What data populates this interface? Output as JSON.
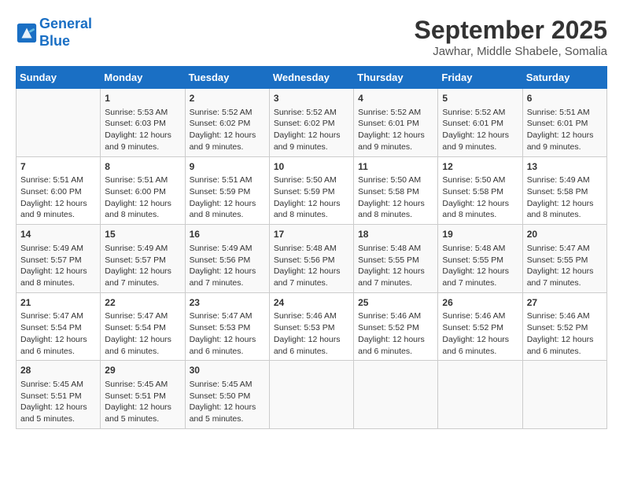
{
  "header": {
    "logo_line1": "General",
    "logo_line2": "Blue",
    "title": "September 2025",
    "subtitle": "Jawhar, Middle Shabele, Somalia"
  },
  "days_of_week": [
    "Sunday",
    "Monday",
    "Tuesday",
    "Wednesday",
    "Thursday",
    "Friday",
    "Saturday"
  ],
  "weeks": [
    [
      {
        "day": "",
        "content": ""
      },
      {
        "day": "1",
        "content": "Sunrise: 5:53 AM\nSunset: 6:03 PM\nDaylight: 12 hours\nand 9 minutes."
      },
      {
        "day": "2",
        "content": "Sunrise: 5:52 AM\nSunset: 6:02 PM\nDaylight: 12 hours\nand 9 minutes."
      },
      {
        "day": "3",
        "content": "Sunrise: 5:52 AM\nSunset: 6:02 PM\nDaylight: 12 hours\nand 9 minutes."
      },
      {
        "day": "4",
        "content": "Sunrise: 5:52 AM\nSunset: 6:01 PM\nDaylight: 12 hours\nand 9 minutes."
      },
      {
        "day": "5",
        "content": "Sunrise: 5:52 AM\nSunset: 6:01 PM\nDaylight: 12 hours\nand 9 minutes."
      },
      {
        "day": "6",
        "content": "Sunrise: 5:51 AM\nSunset: 6:01 PM\nDaylight: 12 hours\nand 9 minutes."
      }
    ],
    [
      {
        "day": "7",
        "content": "Sunrise: 5:51 AM\nSunset: 6:00 PM\nDaylight: 12 hours\nand 9 minutes."
      },
      {
        "day": "8",
        "content": "Sunrise: 5:51 AM\nSunset: 6:00 PM\nDaylight: 12 hours\nand 8 minutes."
      },
      {
        "day": "9",
        "content": "Sunrise: 5:51 AM\nSunset: 5:59 PM\nDaylight: 12 hours\nand 8 minutes."
      },
      {
        "day": "10",
        "content": "Sunrise: 5:50 AM\nSunset: 5:59 PM\nDaylight: 12 hours\nand 8 minutes."
      },
      {
        "day": "11",
        "content": "Sunrise: 5:50 AM\nSunset: 5:58 PM\nDaylight: 12 hours\nand 8 minutes."
      },
      {
        "day": "12",
        "content": "Sunrise: 5:50 AM\nSunset: 5:58 PM\nDaylight: 12 hours\nand 8 minutes."
      },
      {
        "day": "13",
        "content": "Sunrise: 5:49 AM\nSunset: 5:58 PM\nDaylight: 12 hours\nand 8 minutes."
      }
    ],
    [
      {
        "day": "14",
        "content": "Sunrise: 5:49 AM\nSunset: 5:57 PM\nDaylight: 12 hours\nand 8 minutes."
      },
      {
        "day": "15",
        "content": "Sunrise: 5:49 AM\nSunset: 5:57 PM\nDaylight: 12 hours\nand 7 minutes."
      },
      {
        "day": "16",
        "content": "Sunrise: 5:49 AM\nSunset: 5:56 PM\nDaylight: 12 hours\nand 7 minutes."
      },
      {
        "day": "17",
        "content": "Sunrise: 5:48 AM\nSunset: 5:56 PM\nDaylight: 12 hours\nand 7 minutes."
      },
      {
        "day": "18",
        "content": "Sunrise: 5:48 AM\nSunset: 5:55 PM\nDaylight: 12 hours\nand 7 minutes."
      },
      {
        "day": "19",
        "content": "Sunrise: 5:48 AM\nSunset: 5:55 PM\nDaylight: 12 hours\nand 7 minutes."
      },
      {
        "day": "20",
        "content": "Sunrise: 5:47 AM\nSunset: 5:55 PM\nDaylight: 12 hours\nand 7 minutes."
      }
    ],
    [
      {
        "day": "21",
        "content": "Sunrise: 5:47 AM\nSunset: 5:54 PM\nDaylight: 12 hours\nand 6 minutes."
      },
      {
        "day": "22",
        "content": "Sunrise: 5:47 AM\nSunset: 5:54 PM\nDaylight: 12 hours\nand 6 minutes."
      },
      {
        "day": "23",
        "content": "Sunrise: 5:47 AM\nSunset: 5:53 PM\nDaylight: 12 hours\nand 6 minutes."
      },
      {
        "day": "24",
        "content": "Sunrise: 5:46 AM\nSunset: 5:53 PM\nDaylight: 12 hours\nand 6 minutes."
      },
      {
        "day": "25",
        "content": "Sunrise: 5:46 AM\nSunset: 5:52 PM\nDaylight: 12 hours\nand 6 minutes."
      },
      {
        "day": "26",
        "content": "Sunrise: 5:46 AM\nSunset: 5:52 PM\nDaylight: 12 hours\nand 6 minutes."
      },
      {
        "day": "27",
        "content": "Sunrise: 5:46 AM\nSunset: 5:52 PM\nDaylight: 12 hours\nand 6 minutes."
      }
    ],
    [
      {
        "day": "28",
        "content": "Sunrise: 5:45 AM\nSunset: 5:51 PM\nDaylight: 12 hours\nand 5 minutes."
      },
      {
        "day": "29",
        "content": "Sunrise: 5:45 AM\nSunset: 5:51 PM\nDaylight: 12 hours\nand 5 minutes."
      },
      {
        "day": "30",
        "content": "Sunrise: 5:45 AM\nSunset: 5:50 PM\nDaylight: 12 hours\nand 5 minutes."
      },
      {
        "day": "",
        "content": ""
      },
      {
        "day": "",
        "content": ""
      },
      {
        "day": "",
        "content": ""
      },
      {
        "day": "",
        "content": ""
      }
    ]
  ]
}
